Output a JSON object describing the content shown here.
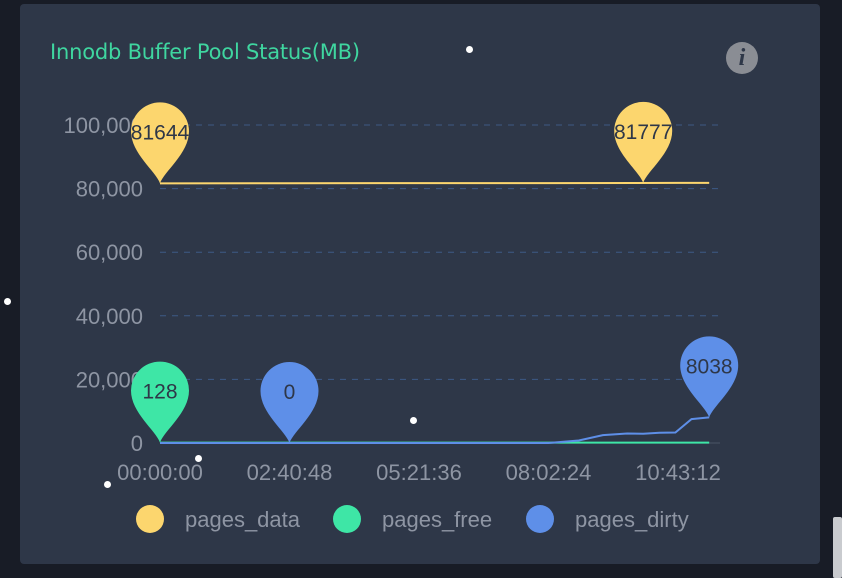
{
  "panel": {
    "title": "Innodb Buffer Pool Status(MB)",
    "info_icon": "info-icon",
    "info_glyph": "i"
  },
  "chart_data": {
    "type": "line",
    "title": "Innodb Buffer Pool Status(MB)",
    "xlabel": "",
    "ylabel": "",
    "x_ticks": [
      "00:00:00",
      "02:40:48",
      "05:21:36",
      "08:02:24",
      "10:43:12"
    ],
    "y_ticks": [
      "0",
      "20,000",
      "40,000",
      "60,000",
      "80,000",
      "100,000"
    ],
    "ylim": [
      0,
      100000
    ],
    "grid": true,
    "legend": "bottom",
    "series": [
      {
        "name": "pages_data",
        "color": "#fcd66e",
        "x": [
          "00:00:00",
          "02:40:48",
          "05:21:36",
          "08:02:24",
          "10:43:12",
          "11:22:00"
        ],
        "values": [
          81644,
          81700,
          81720,
          81740,
          81777,
          81777
        ],
        "markers": [
          {
            "label": "81644",
            "kind": "min",
            "x": "00:00:00",
            "value": 81644
          },
          {
            "label": "81777",
            "kind": "max",
            "x": "10:00:00",
            "value": 81777
          }
        ]
      },
      {
        "name": "pages_free",
        "color": "#3ee6a6",
        "x": [
          "00:00:00",
          "02:40:48",
          "05:21:36",
          "08:02:24",
          "10:43:12",
          "11:22:00"
        ],
        "values": [
          128,
          128,
          128,
          128,
          128,
          128
        ],
        "markers": [
          {
            "label": "128",
            "kind": "max",
            "x": "00:00:00",
            "value": 128
          }
        ]
      },
      {
        "name": "pages_dirty",
        "color": "#5e8fe8",
        "x": [
          "00:00:00",
          "02:40:48",
          "05:21:36",
          "08:02:24",
          "08:40:00",
          "09:10:00",
          "09:40:00",
          "10:00:00",
          "10:20:00",
          "10:40:00",
          "11:00:00",
          "11:22:00"
        ],
        "values": [
          0,
          0,
          0,
          0,
          800,
          2500,
          3000,
          2900,
          3200,
          3300,
          7500,
          8038
        ],
        "markers": [
          {
            "label": "0",
            "kind": "min",
            "x": "02:40:48",
            "value": 0
          },
          {
            "label": "8038",
            "kind": "max",
            "x": "11:22:00",
            "value": 8038
          }
        ]
      }
    ]
  }
}
